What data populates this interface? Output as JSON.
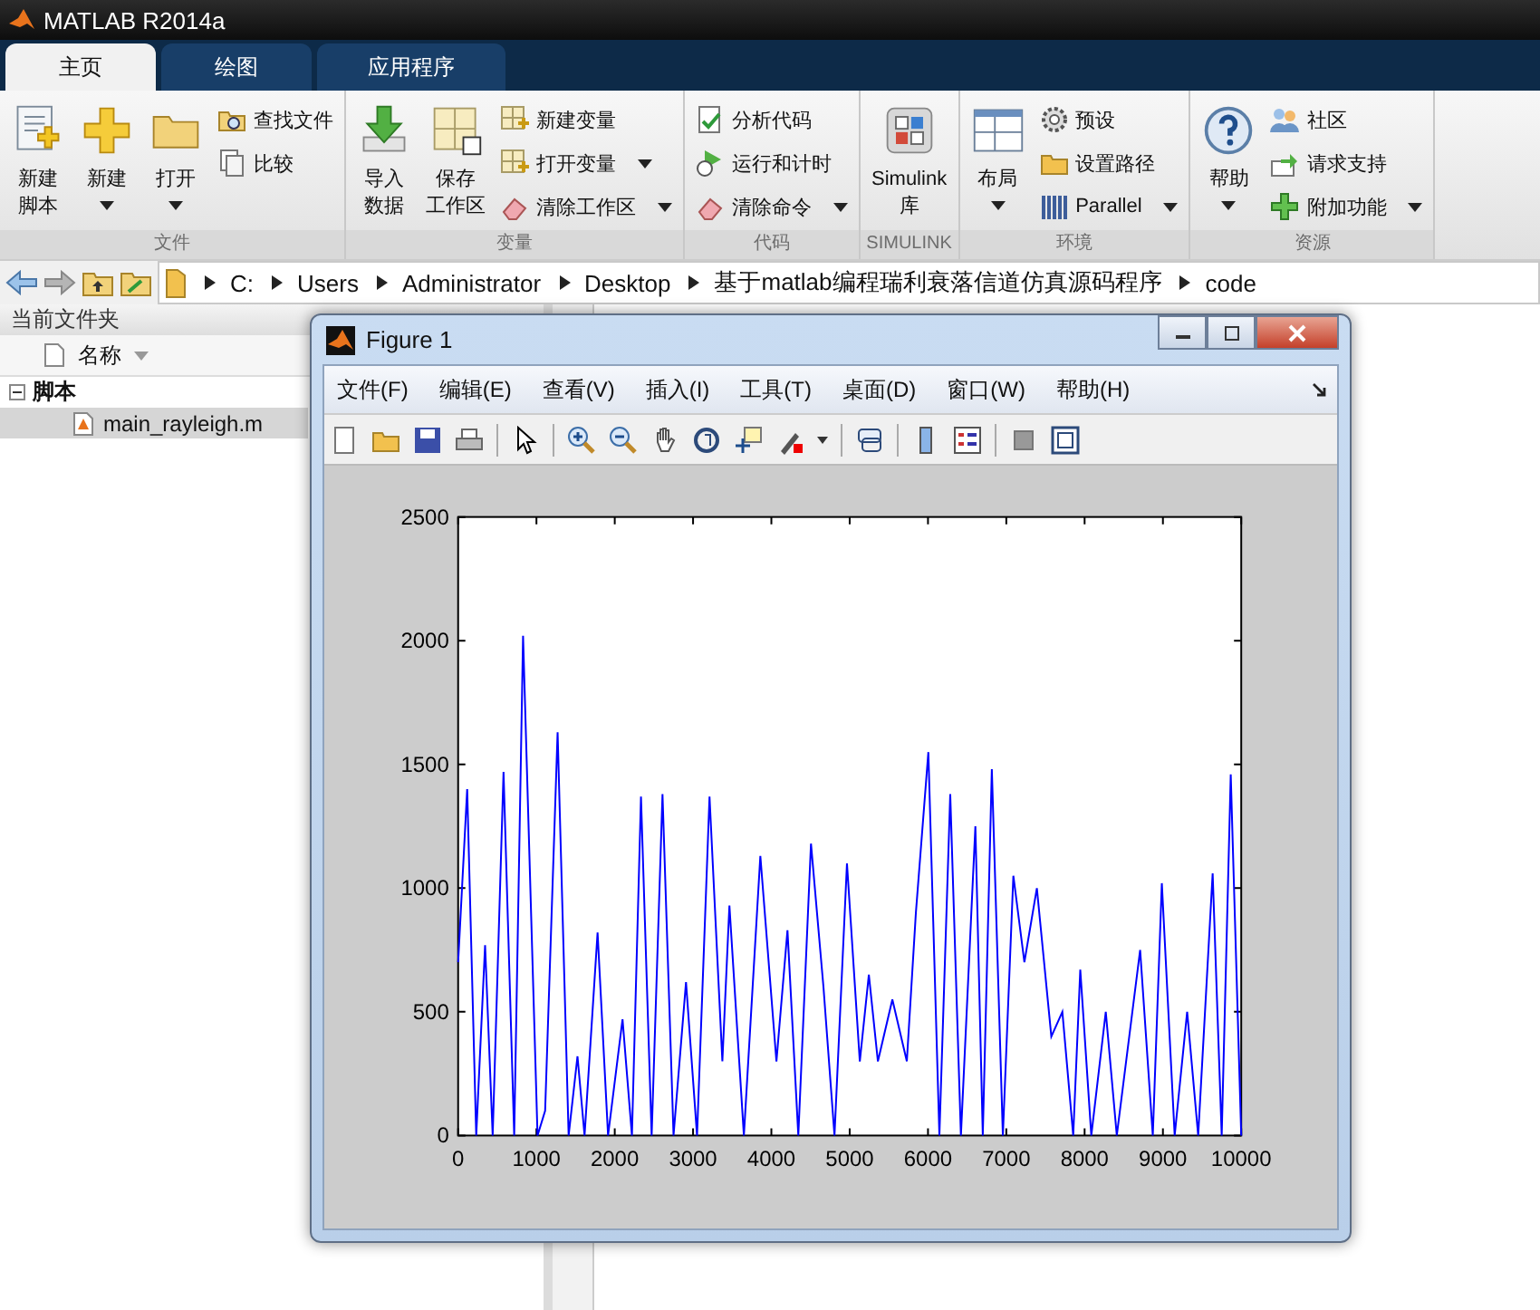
{
  "window": {
    "title": "MATLAB R2014a"
  },
  "tabs": [
    {
      "label": "主页",
      "selected": true
    },
    {
      "label": "绘图",
      "selected": false
    },
    {
      "label": "应用程序",
      "selected": false
    }
  ],
  "ribbon": {
    "groups": [
      {
        "label": "文件",
        "items": [
          {
            "kind": "large",
            "label": [
              "新建",
              "脚本"
            ],
            "dropdown": false
          },
          {
            "kind": "large",
            "label": [
              "新建"
            ],
            "dropdown": true
          },
          {
            "kind": "large",
            "label": [
              "打开"
            ],
            "dropdown": true
          },
          {
            "kind": "small",
            "label": "查找文件",
            "dropdown": false
          },
          {
            "kind": "small",
            "label": "比较",
            "dropdown": false
          }
        ]
      },
      {
        "label": "变量",
        "items": [
          {
            "kind": "large",
            "label": [
              "导入",
              "数据"
            ],
            "dropdown": false
          },
          {
            "kind": "large",
            "label": [
              "保存",
              "工作区"
            ],
            "dropdown": false
          },
          {
            "kind": "small",
            "label": "新建变量",
            "dropdown": false
          },
          {
            "kind": "small",
            "label": "打开变量",
            "dropdown": true
          },
          {
            "kind": "small",
            "label": "清除工作区",
            "dropdown": true
          }
        ]
      },
      {
        "label": "代码",
        "items": [
          {
            "kind": "small",
            "label": "分析代码",
            "dropdown": false
          },
          {
            "kind": "small",
            "label": "运行和计时",
            "dropdown": false
          },
          {
            "kind": "small",
            "label": "清除命令",
            "dropdown": true
          }
        ]
      },
      {
        "label": "SIMULINK",
        "items": [
          {
            "kind": "large",
            "label": [
              "Simulink",
              "库"
            ],
            "dropdown": false
          }
        ]
      },
      {
        "label": "环境",
        "items": [
          {
            "kind": "large",
            "label": [
              "布局"
            ],
            "dropdown": true
          },
          {
            "kind": "small",
            "label": "预设",
            "dropdown": false
          },
          {
            "kind": "small",
            "label": "设置路径",
            "dropdown": false
          },
          {
            "kind": "small",
            "label": "Parallel",
            "dropdown": true
          }
        ]
      },
      {
        "label": "资源",
        "items": [
          {
            "kind": "large",
            "label": [
              "帮助"
            ],
            "dropdown": true
          },
          {
            "kind": "small",
            "label": "社区",
            "dropdown": false
          },
          {
            "kind": "small",
            "label": "请求支持",
            "dropdown": false
          },
          {
            "kind": "small",
            "label": "附加功能",
            "dropdown": true
          }
        ]
      }
    ]
  },
  "address_bar": {
    "path": [
      "C:",
      "Users",
      "Administrator",
      "Desktop",
      "基于matlab编程瑞利衰落信道仿真源码程序",
      "code"
    ]
  },
  "folder_panel": {
    "title": "当前文件夹",
    "column": "名称",
    "tree": [
      {
        "label": "脚本",
        "expanded": true,
        "children": [
          {
            "label": "main_rayleigh.m",
            "selected": true
          }
        ]
      }
    ]
  },
  "figure": {
    "title": "Figure 1",
    "menu": [
      "文件(F)",
      "编辑(E)",
      "查看(V)",
      "插入(I)",
      "工具(T)",
      "桌面(D)",
      "窗口(W)",
      "帮助(H)"
    ],
    "chart_data": {
      "type": "line",
      "xlim": [
        0,
        10000
      ],
      "ylim": [
        0,
        2500
      ],
      "xticks": [
        0,
        1000,
        2000,
        3000,
        4000,
        5000,
        6000,
        7000,
        8000,
        9000,
        10000
      ],
      "yticks": [
        0,
        500,
        1000,
        1500,
        2000,
        2500
      ],
      "x": [
        0,
        115,
        230,
        345,
        440,
        580,
        715,
        830,
        1015,
        1110,
        1270,
        1410,
        1525,
        1615,
        1780,
        1915,
        2100,
        2220,
        2335,
        2470,
        2610,
        2750,
        2910,
        3050,
        3210,
        3375,
        3465,
        3650,
        3860,
        4065,
        4205,
        4345,
        4505,
        4665,
        4805,
        4965,
        5130,
        5245,
        5360,
        5545,
        5730,
        5845,
        6005,
        6145,
        6285,
        6420,
        6605,
        6700,
        6815,
        6955,
        7090,
        7230,
        7390,
        7575,
        7715,
        7855,
        7945,
        8085,
        8270,
        8410,
        8710,
        8870,
        8985,
        9150,
        9310,
        9450,
        9635,
        9750,
        9865,
        10000
      ],
      "series": [
        {
          "color": "#0000ff",
          "values": [
            700,
            1400,
            0,
            770,
            0,
            1470,
            0,
            2020,
            0,
            100,
            1630,
            0,
            320,
            0,
            820,
            0,
            470,
            0,
            1370,
            0,
            1380,
            0,
            620,
            0,
            1370,
            300,
            930,
            0,
            1130,
            300,
            830,
            0,
            1180,
            600,
            0,
            1100,
            300,
            650,
            300,
            550,
            300,
            900,
            1550,
            0,
            1380,
            0,
            1250,
            0,
            1480,
            0,
            1050,
            700,
            1000,
            400,
            500,
            0,
            670,
            0,
            500,
            0,
            750,
            0,
            1020,
            0,
            500,
            0,
            1060,
            0,
            1460,
            0
          ]
        }
      ]
    }
  }
}
